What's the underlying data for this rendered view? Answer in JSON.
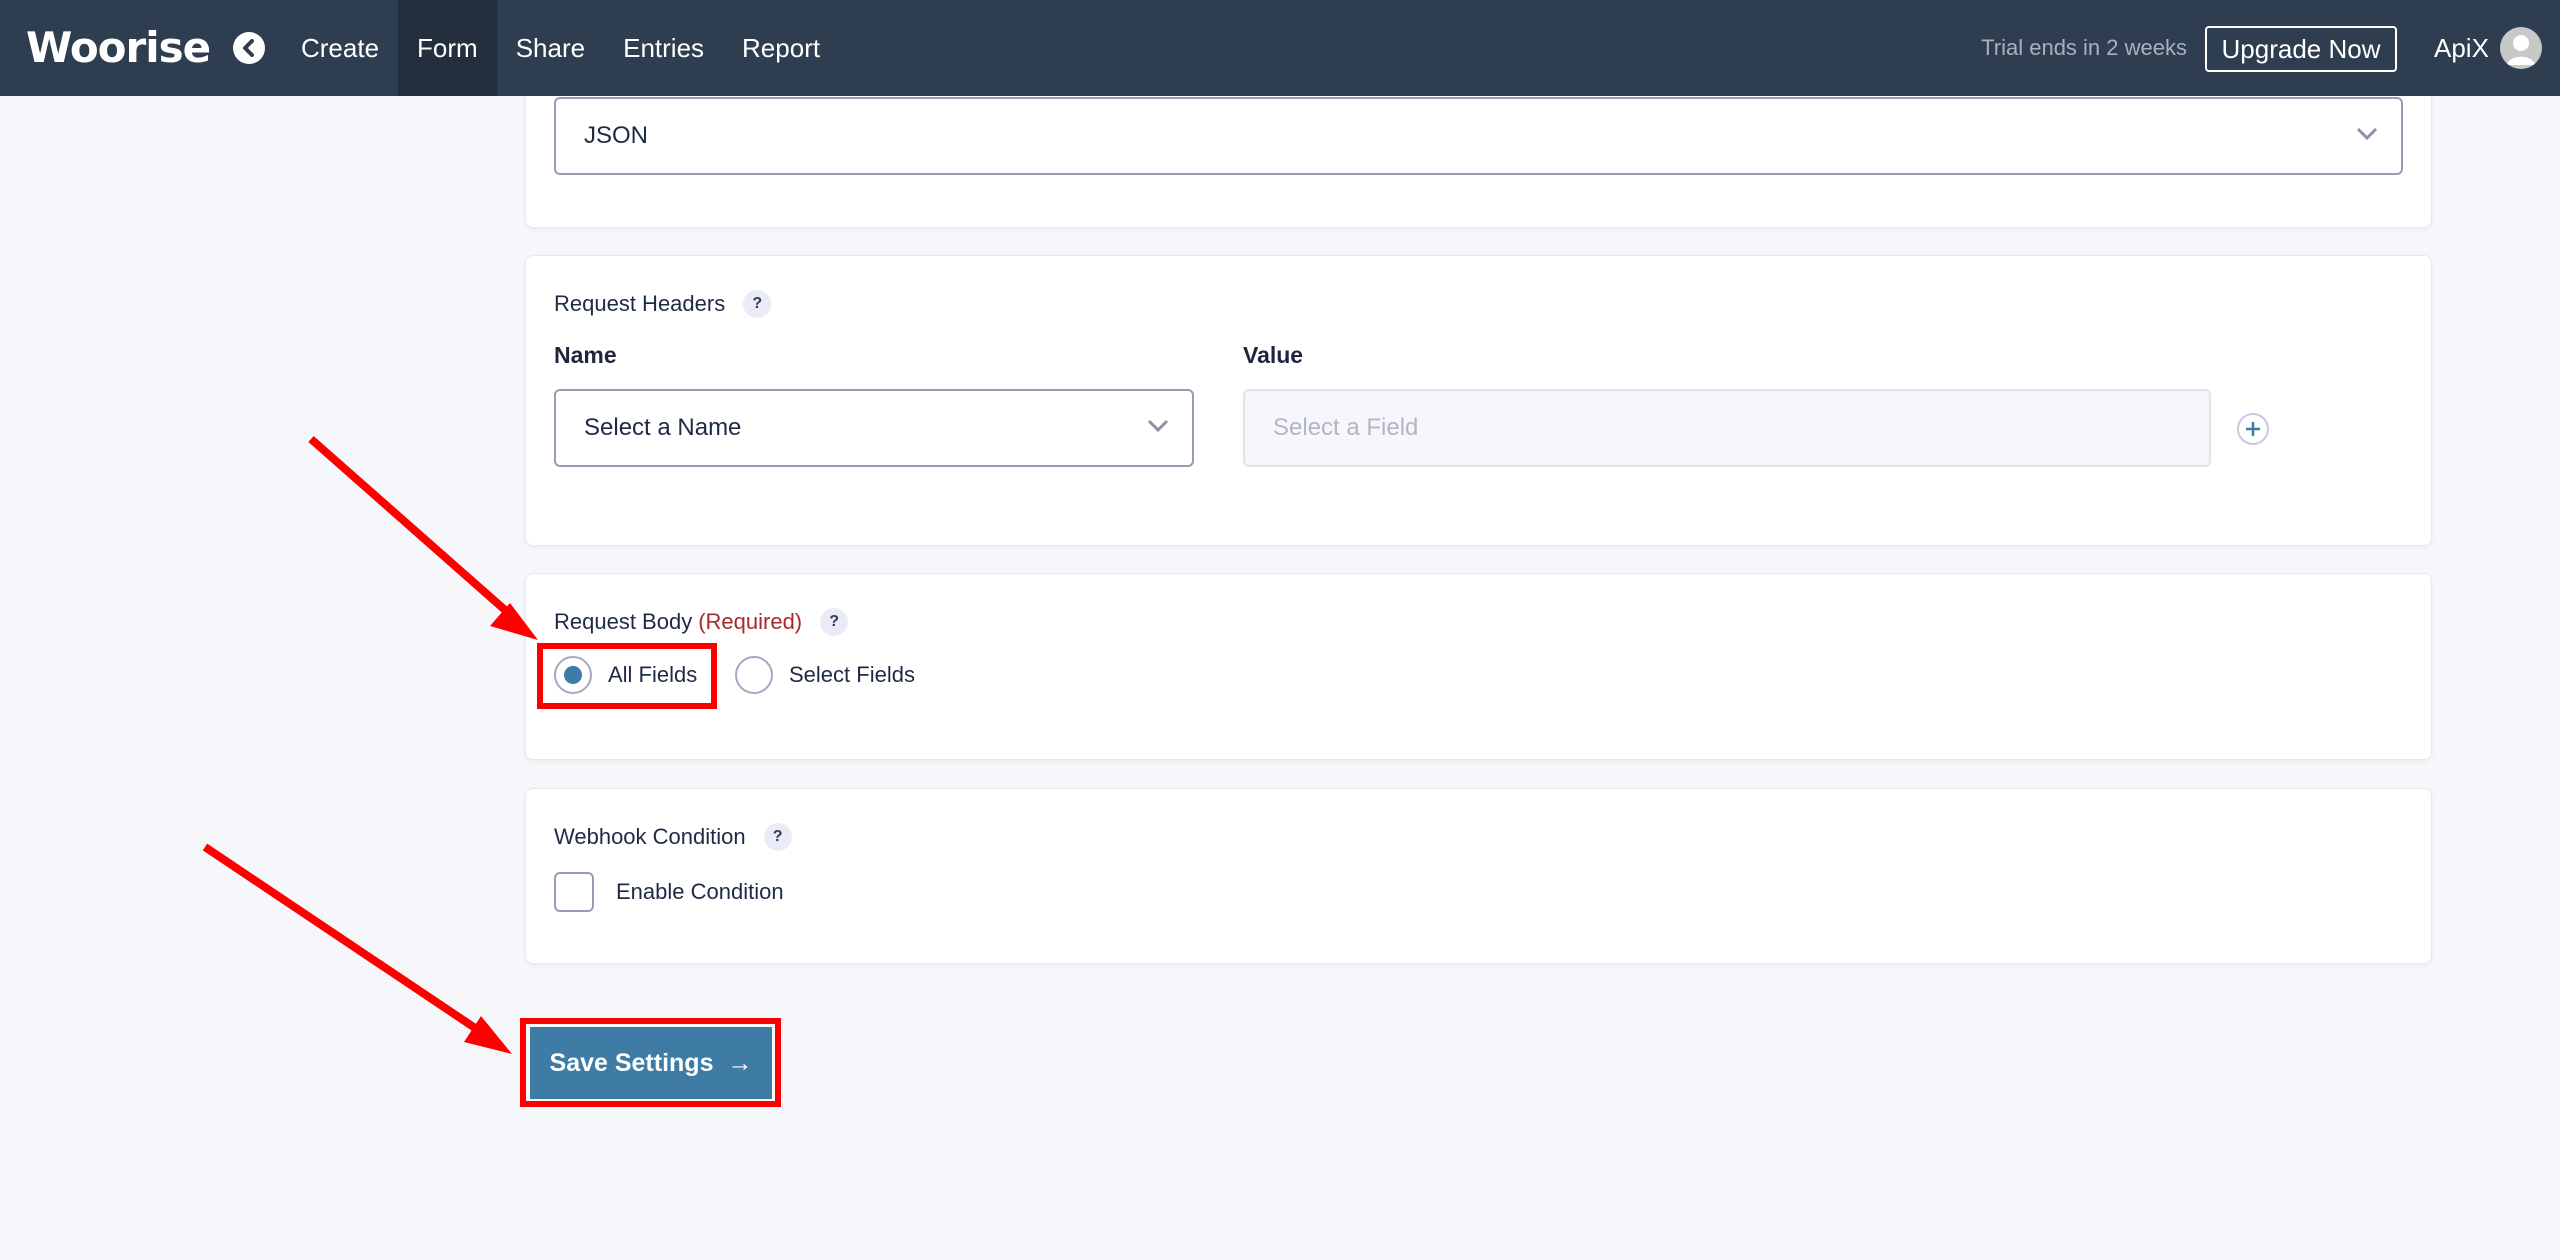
{
  "header": {
    "logo": "Woorise",
    "nav": [
      {
        "label": "Create",
        "active": false
      },
      {
        "label": "Form",
        "active": true
      },
      {
        "label": "Share",
        "active": false
      },
      {
        "label": "Entries",
        "active": false
      },
      {
        "label": "Report",
        "active": false
      }
    ],
    "trial_text": "Trial ends in 2 weeks",
    "upgrade_label": "Upgrade Now",
    "user_name": "ApiX"
  },
  "format_card": {
    "selected_value": "JSON"
  },
  "request_headers": {
    "label": "Request Headers",
    "help": "?",
    "name_label": "Name",
    "value_label": "Value",
    "name_select": "Select a Name",
    "value_placeholder": "Select a Field"
  },
  "request_body": {
    "label": "Request Body",
    "required": "(Required)",
    "help": "?",
    "options": [
      {
        "label": "All Fields",
        "selected": true
      },
      {
        "label": "Select Fields",
        "selected": false
      }
    ]
  },
  "webhook_condition": {
    "label": "Webhook Condition",
    "help": "?",
    "checkbox_label": "Enable Condition",
    "checked": false
  },
  "save_button": {
    "label": "Save Settings",
    "arrow": "→"
  },
  "colors": {
    "header_bg": "#2e3d4f",
    "accent": "#3e7ca6",
    "required": "#a82a2a",
    "annotation": "#ff0000"
  }
}
